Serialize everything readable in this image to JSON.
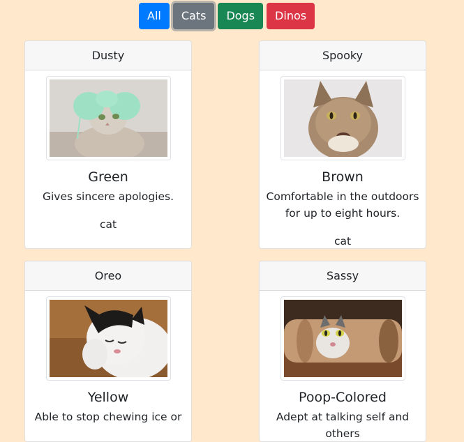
{
  "filters": {
    "all": "All",
    "cats": "Cats",
    "dogs": "Dogs",
    "dinos": "Dinos"
  },
  "pets": [
    {
      "name": "Dusty",
      "color": "Green",
      "description": "Gives sincere apologies.",
      "type": "cat",
      "photo_hint": "cat-with-green-yarn-buns"
    },
    {
      "name": "Spooky",
      "color": "Brown",
      "description": "Comfortable in the outdoors for up to eight hours.",
      "type": "cat",
      "photo_hint": "maine-coon-cat"
    },
    {
      "name": "Oreo",
      "color": "Yellow",
      "description": "Able to stop chewing ice or",
      "type": "",
      "photo_hint": "black-white-cat-yawning"
    },
    {
      "name": "Sassy",
      "color": "Poop-Colored",
      "description": "Adept at talking self and others",
      "type": "",
      "photo_hint": "cat-in-paper-tube"
    }
  ]
}
